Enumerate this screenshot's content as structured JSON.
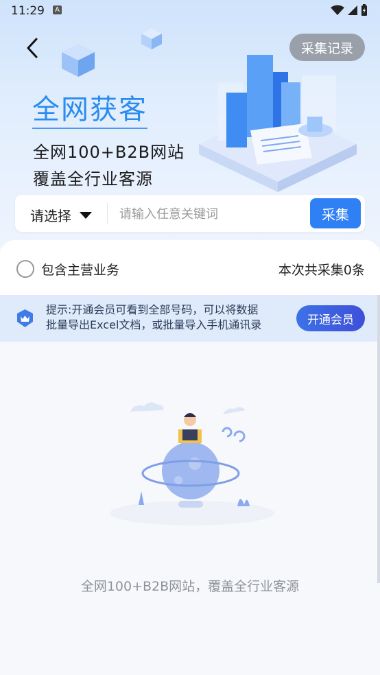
{
  "status_bar": {
    "time": "11:29",
    "notif_badge": "A"
  },
  "header": {
    "record_label": "采集记录"
  },
  "hero": {
    "title": "全网获客",
    "line1": "全网100+B2B网站",
    "line2": "覆盖全行业客源"
  },
  "search": {
    "select_label": "请选择",
    "placeholder": "请输入任意关键词",
    "button_label": "采集"
  },
  "options": {
    "include_main_business": "包含主营业务",
    "count_text": "本次共采集0条"
  },
  "tip": {
    "line1": "提示:开通会员可看到全部号码，可以将数据",
    "line2": "批量导出Excel文档，或批量导入手机通讯录",
    "button_label": "开通会员"
  },
  "empty": {
    "message": "全网100+B2B网站，覆盖全行业客源"
  },
  "colors": {
    "accent": "#2f7ff5",
    "title_blue": "#2a8cf0",
    "record_btn": "#9aa0aa",
    "vip_btn": "#3d5fe0"
  }
}
